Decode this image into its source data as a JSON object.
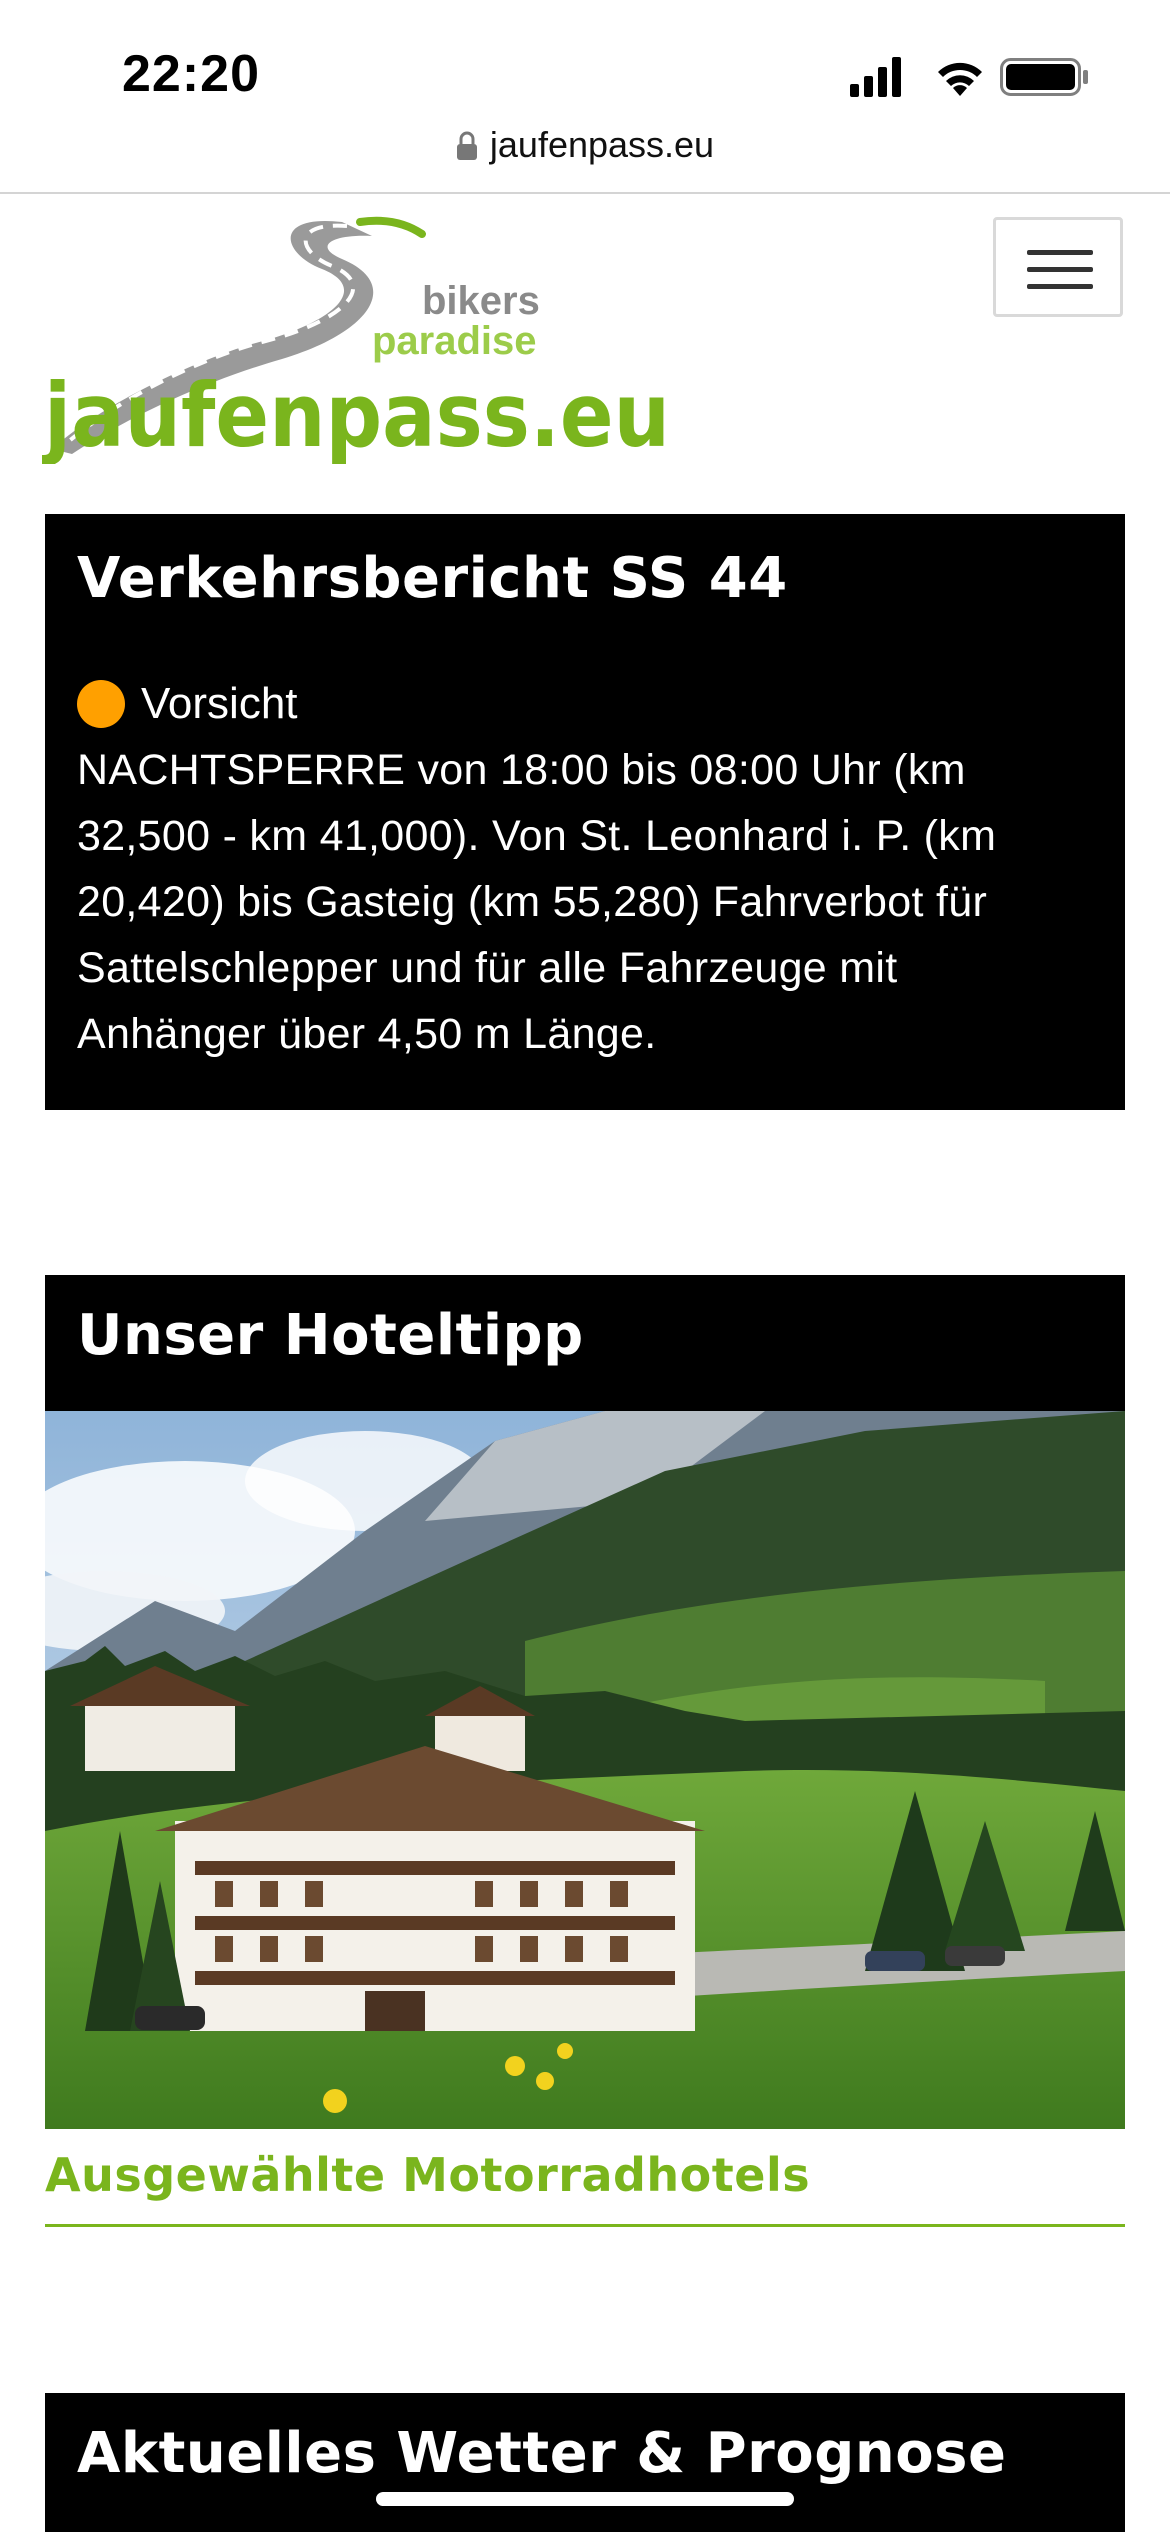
{
  "status_bar": {
    "time": "22:20"
  },
  "browser": {
    "url": "jaufenpass.eu"
  },
  "header": {
    "logo_text": "jaufenpass.eu",
    "logo_tagline_1": "bikers",
    "logo_tagline_2": "paradise"
  },
  "traffic": {
    "title": "Verkehrsbericht SS 44",
    "status_label": "Vorsicht",
    "status_color": "#ffa000",
    "message": "NACHTSPERRE von 18:00 bis 08:00 Uhr (km 32,500 - km 41,000). Von St. Leonhard i. P. (km 20,420) bis Gasteig (km 55,280) Fahrverbot für Sattelschlepper und für alle Fahrzeuge mit Anhänger über 4,50 m Länge."
  },
  "hotel": {
    "title": "Unser Hoteltipp",
    "link_label": "Ausgewählte Motorradhotels"
  },
  "weather": {
    "title": "Aktuelles Wetter & Prognose"
  },
  "colors": {
    "accent_green": "#7ab51d",
    "panel_bg": "#000000"
  }
}
